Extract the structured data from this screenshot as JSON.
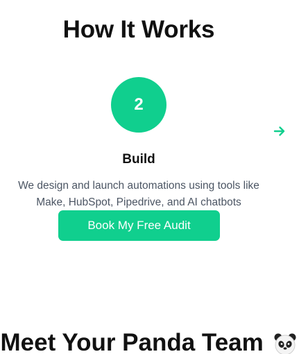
{
  "how_it_works": {
    "title": "How It Works",
    "step": {
      "number": "2",
      "title": "Build",
      "description_line1": "We design and launch automations using tools like",
      "description_line2": "Make, HubSpot, Pipedrive, and AI chatbots"
    },
    "next_icon": "arrow-right-icon",
    "cta_label": "Book My Free Audit"
  },
  "team": {
    "title": "Meet Your Panda Team",
    "emoji_icon": "panda-face-icon"
  },
  "colors": {
    "accent": "#10cf8e",
    "text": "#111111",
    "muted": "#4b5563"
  }
}
